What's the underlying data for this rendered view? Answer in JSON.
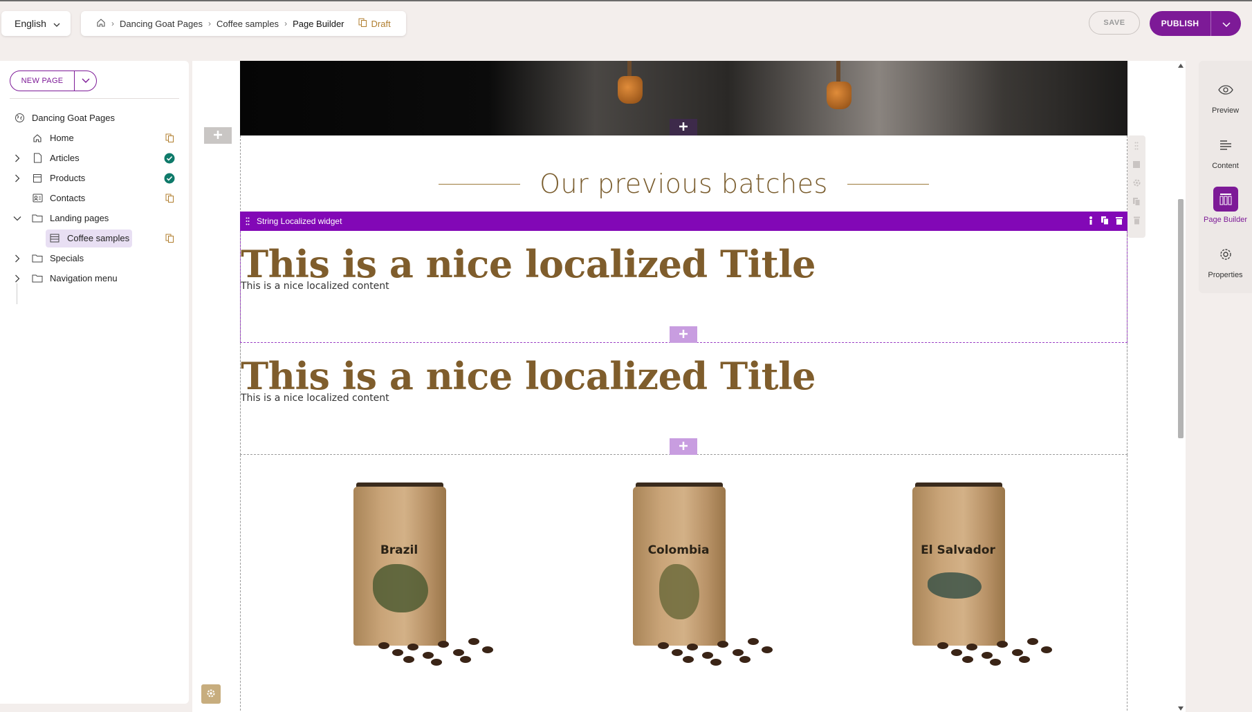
{
  "top_bar": {
    "language": "English",
    "breadcrumb": [
      "Dancing Goat Pages",
      "Coffee samples",
      "Page Builder"
    ],
    "status": "Draft",
    "save_label": "SAVE",
    "publish_label": "PUBLISH"
  },
  "left_panel": {
    "new_page_label": "NEW PAGE",
    "tree": [
      {
        "label": "Dancing Goat Pages",
        "icon": "globe-icon"
      },
      {
        "label": "Home",
        "icon": "home-icon",
        "status": "draft"
      },
      {
        "label": "Articles",
        "icon": "page-icon",
        "status": "published"
      },
      {
        "label": "Products",
        "icon": "page-list-icon",
        "status": "published"
      },
      {
        "label": "Contacts",
        "icon": "contacts-icon",
        "status": "draft"
      },
      {
        "label": "Landing pages",
        "icon": "folder-icon"
      },
      {
        "label": "Coffee samples",
        "icon": "layout-icon",
        "status": "draft"
      },
      {
        "label": "Specials",
        "icon": "folder-icon"
      },
      {
        "label": "Navigation menu",
        "icon": "folder-icon"
      }
    ]
  },
  "canvas": {
    "section_heading": "Our previous batches",
    "widget_name": "String Localized widget",
    "blocks": [
      {
        "title": "This is a nice localized Title",
        "content": "This is a nice localized content"
      },
      {
        "title": "This is a nice localized Title",
        "content": "This is a nice localized content"
      }
    ],
    "bags": [
      "Brazil",
      "Colombia",
      "El Salvador"
    ]
  },
  "right_panel": {
    "items": [
      "Preview",
      "Content",
      "Page Builder",
      "Properties"
    ]
  },
  "colors": {
    "accent": "#7d1a97",
    "widget_bar": "#8208b6",
    "title_brown": "#7f5d2c",
    "status_green": "#0f7a6a",
    "draft_gold": "#b07d2d"
  }
}
